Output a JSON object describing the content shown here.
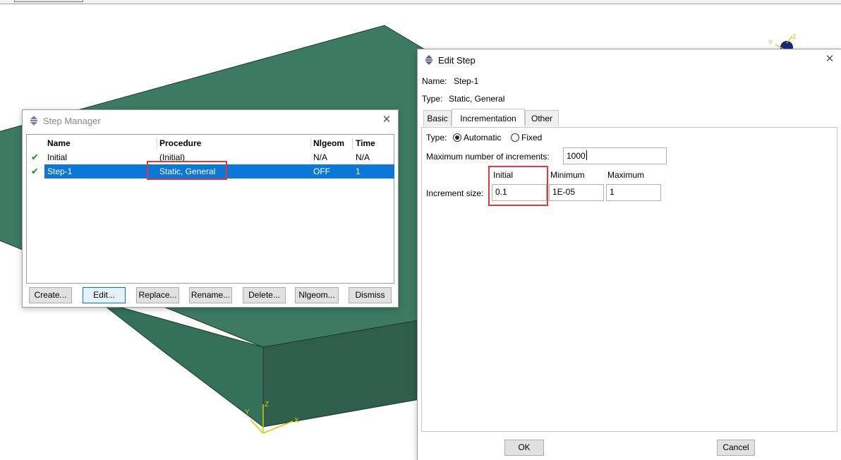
{
  "colors": {
    "model_face": "#3d7a63",
    "model_side": "#2f5e4d",
    "selection": "#0b78d7",
    "highlight": "#e0383e",
    "check": "#1d8f1d"
  },
  "viewport": {
    "triad_main": {
      "x": "X",
      "y": "Y",
      "z": "Z"
    },
    "triad_corner": {
      "y": "Y",
      "z": "Z"
    }
  },
  "step_manager": {
    "title": "Step Manager",
    "close_icon": "close-icon",
    "columns": [
      "Name",
      "Procedure",
      "Nlgeom",
      "Time"
    ],
    "rows": [
      {
        "name": "Initial",
        "procedure": "(Initial)",
        "nlgeom": "N/A",
        "time": "N/A",
        "status_icon": "check-icon",
        "selected": false
      },
      {
        "name": "Step-1",
        "procedure": "Static, General",
        "nlgeom": "OFF",
        "time": "1",
        "status_icon": "check-icon",
        "selected": true
      }
    ],
    "buttons": {
      "create": "Create...",
      "edit": "Edit...",
      "replace": "Replace...",
      "rename": "Rename...",
      "delete": "Delete...",
      "nlgeom": "Nlgeom...",
      "dismiss": "Dismiss"
    }
  },
  "edit_step": {
    "title": "Edit Step",
    "name_label": "Name:",
    "name_value": "Step-1",
    "type_label": "Type:",
    "type_value": "Static, General",
    "tabs": [
      "Basic",
      "Incrementation",
      "Other"
    ],
    "active_tab": "Incrementation",
    "incrementation": {
      "type_label": "Type:",
      "type_options": [
        "Automatic",
        "Fixed"
      ],
      "type_selected": "Automatic",
      "max_increments_label": "Maximum number of increments:",
      "max_increments_value": "1000",
      "col_initial": "Initial",
      "col_minimum": "Minimum",
      "col_maximum": "Maximum",
      "increment_size_label": "Increment size:",
      "initial_value": "0.1",
      "minimum_value": "1E-05",
      "maximum_value": "1"
    },
    "buttons": {
      "ok": "OK",
      "cancel": "Cancel"
    }
  }
}
